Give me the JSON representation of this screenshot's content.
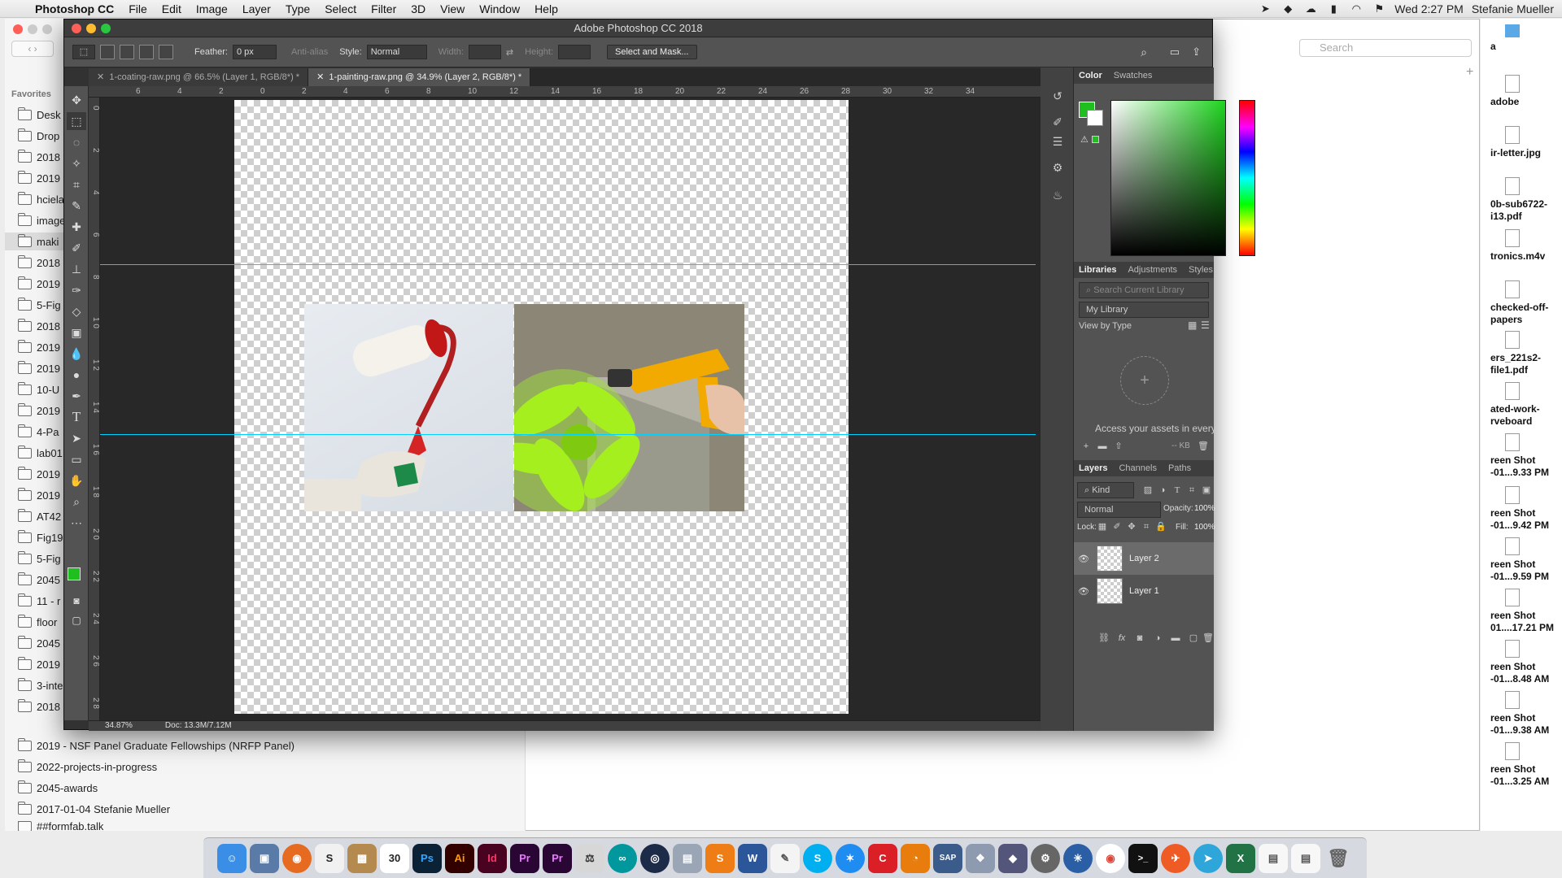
{
  "menubar": {
    "app": "Photoshop CC",
    "items": [
      "File",
      "Edit",
      "Image",
      "Layer",
      "Type",
      "Select",
      "Filter",
      "3D",
      "View",
      "Window",
      "Help"
    ],
    "clock": "Wed 2:27 PM",
    "user": "Stefanie Mueller"
  },
  "finder": {
    "search_placeholder": "Search",
    "favorites_label": "Favorites",
    "sidebar_items": [
      "Desk",
      "Drop",
      "2018",
      "2019",
      "hcielab",
      "image",
      "maki",
      "2018",
      "2019",
      "5-Fig",
      "2018",
      "2019",
      "2019",
      "10-U",
      "2019",
      "4-Pa",
      "lab01",
      "2019",
      "2019",
      "AT42",
      "Fig19",
      "5-Fig",
      "2045",
      "11 - r",
      "floor",
      "2045",
      "2019",
      "3-inte",
      "2018"
    ],
    "list_items": [
      "2019 - NSF Panel Graduate Fellowships (NRFP Panel)",
      "2022-projects-in-progress",
      "2045-awards",
      "2017-01-04 Stefanie Mueller",
      "##formfab.talk"
    ]
  },
  "desktop": {
    "items": [
      "a",
      "adobe",
      "ir-letter.jpg",
      "0b-sub6722-i13.pdf",
      "tronics.m4v",
      "checked-off-papers",
      "ers_221s2-file1.pdf",
      "ated-work-rveboard",
      "reen Shot -01...9.33 PM",
      "reen Shot -01...9.42 PM",
      "reen Shot -01...9.59 PM",
      "reen Shot 01....17.21 PM",
      "reen Shot -01...8.48 AM",
      "reen Shot -01...9.38 AM",
      "reen Shot -01...3.25 AM"
    ]
  },
  "ps": {
    "title": "Adobe Photoshop CC 2018",
    "options": {
      "feather_label": "Feather:",
      "feather_value": "0 px",
      "antialias": "Anti-alias",
      "style_label": "Style:",
      "style_value": "Normal",
      "width_label": "Width:",
      "height_label": "Height:",
      "select_mask": "Select and Mask..."
    },
    "tabs": [
      "1-coating-raw.png @ 66.5% (Layer 1, RGB/8*) *",
      "1-painting-raw.png @ 34.9% (Layer 2, RGB/8*) *"
    ],
    "ruler_top": [
      "6",
      "4",
      "2",
      "0",
      "2",
      "4",
      "6",
      "8",
      "10",
      "12",
      "14",
      "16",
      "18",
      "20",
      "22",
      "24",
      "26",
      "28",
      "30",
      "32",
      "34"
    ],
    "ruler_left": [
      "0",
      "2",
      "4",
      "6",
      "8",
      "1 0",
      "1 2",
      "1 4",
      "1 6",
      "1 8",
      "2 0",
      "2 2",
      "2 4",
      "2 6",
      "2 8"
    ],
    "status": {
      "zoom": "34.87%",
      "doc": "Doc: 13.3M/7.12M"
    },
    "color_panel": {
      "tab1": "Color",
      "tab2": "Swatches",
      "fg": "#1fbf1f"
    },
    "libraries": {
      "tab1": "Libraries",
      "tab2": "Adjustments",
      "tab3": "Styles",
      "search_placeholder": "Search Current Library",
      "library": "My Library",
      "view": "View by Type",
      "access": "Access your assets in every",
      "size": "-- KB"
    },
    "layers_panel": {
      "tab1": "Layers",
      "tab2": "Channels",
      "tab3": "Paths",
      "kind": "Kind",
      "blend": "Normal",
      "opacity_label": "Opacity:",
      "opacity": "100%",
      "lock_label": "Lock:",
      "fill_label": "Fill:",
      "fill": "100%",
      "layers": [
        "Layer 2",
        "Layer 1"
      ]
    }
  },
  "dock": [
    "Finder",
    "Preview",
    "Firefox",
    "Scrivener",
    "Stuffit",
    "Calendar",
    "Ps",
    "Ai",
    "Id",
    "Pr",
    "Pr",
    "Tex",
    "Arduino",
    "Quicktime",
    "Migration",
    "Sublime",
    "Word",
    "Pages",
    "Skype",
    "Safari",
    "Creative Cloud",
    "Blender",
    "SAP",
    "Preview",
    "Photos",
    "Alfred",
    "System Prefs",
    "Network",
    "Chrome",
    "Terminal",
    "Postman",
    "Telegram",
    "Excel",
    "Doc",
    "Doc",
    "Trash"
  ],
  "dock_labels": {
    "ps": "Ps",
    "ai": "Ai",
    "id": "Id",
    "pr": "Pr",
    "cal": "30",
    "sap": "SAP",
    "s": "S",
    "c": "C"
  }
}
